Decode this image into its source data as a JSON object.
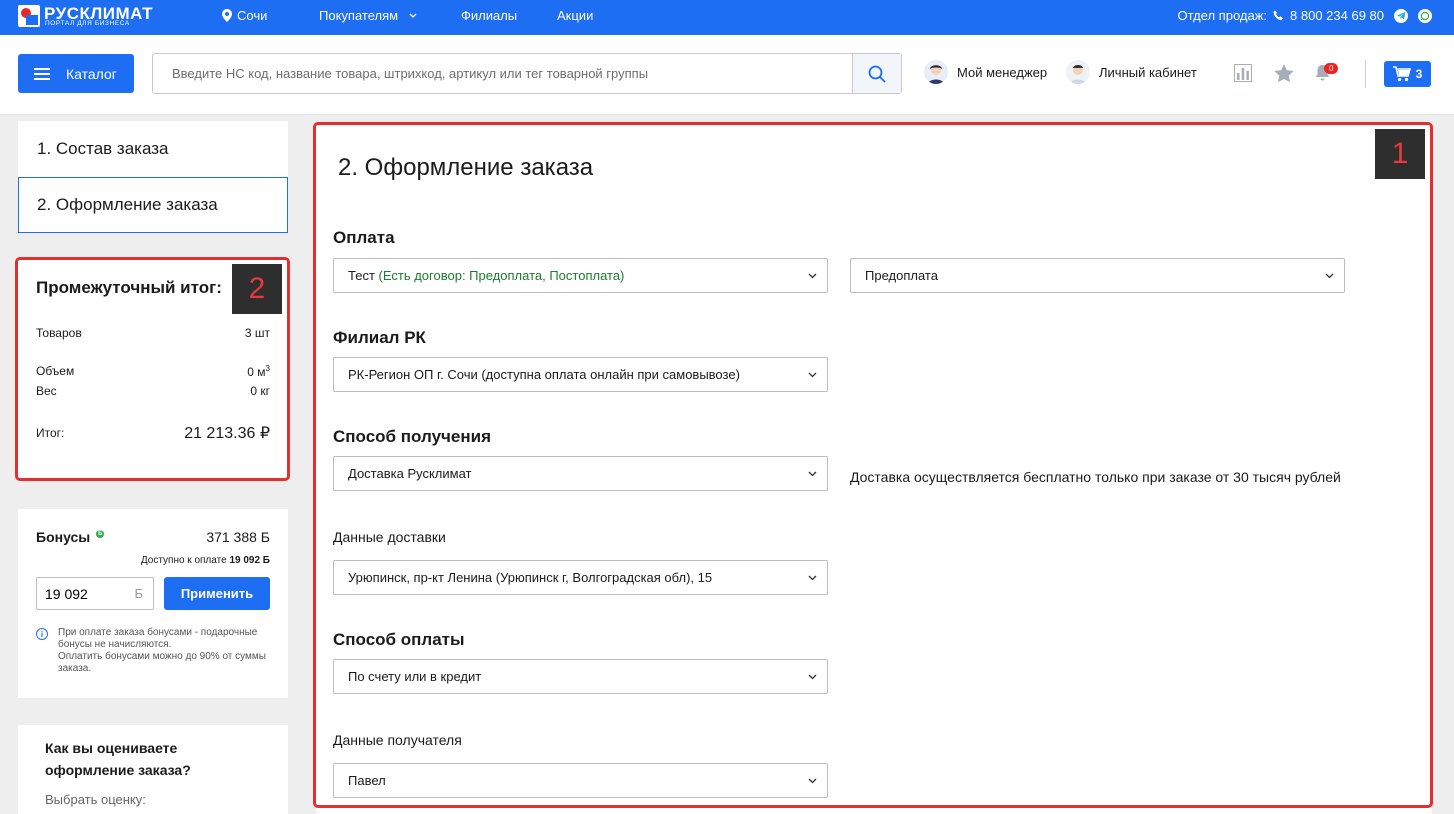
{
  "topbar": {
    "logo_text": "РУСКЛИМАТ",
    "logo_sub": "ПОРТАЛ ДЛЯ БИЗНЕСА",
    "city": "Сочи",
    "nav": [
      "Покупателям",
      "Филиалы",
      "Акции"
    ],
    "sales_label": "Отдел продаж:",
    "phone": "8 800 234 69 80"
  },
  "header": {
    "catalog_label": "Каталог",
    "search_placeholder": "Введите НС код, название товара, штрихкод, артикул или тег товарной группы",
    "manager_label": "Мой менеджер",
    "cabinet_label": "Личный кабинет",
    "notif_count": "0",
    "cart_count": "3"
  },
  "steps": [
    "1. Состав заказа",
    "2. Оформление заказа"
  ],
  "subtotal": {
    "title": "Промежуточный итог:",
    "goods_label": "Товаров",
    "goods_value": "3 шт",
    "volume_label": "Объем",
    "volume_value": "0 м",
    "volume_sup": "3",
    "weight_label": "Вес",
    "weight_value": "0 кг",
    "total_label": "Итог:",
    "total_value": "21 213.36 ₽"
  },
  "bonus": {
    "title": "Бонусы",
    "icon_char": "Б",
    "value": "371 388 Б",
    "avail_label": "Доступно к оплате",
    "avail_value": "19 092 Б",
    "input_value": "19 092",
    "input_unit": "Б",
    "apply_label": "Применить",
    "note1": "При оплате заказа бонусами - подарочные бонусы не начисляются.",
    "note2": "Оплатить бонусами можно до 90% от суммы заказа."
  },
  "rating": {
    "title": "Как вы оцениваете оформление заказа?",
    "subtitle": "Выбрать оценку:"
  },
  "markers": [
    "1",
    "2"
  ],
  "checkout": {
    "title": "2. Оформление заказа",
    "payment_heading": "Оплата",
    "payer_name": "Тест",
    "payer_contract": "(Есть договор: Предоплата, Постоплата)",
    "payment_type": "Предоплата",
    "branch_heading": "Филиал РК",
    "branch_value": "РК-Регион ОП г. Сочи (доступна оплата онлайн при самовывозе)",
    "receive_heading": "Способ получения",
    "receive_value": "Доставка Русклимат",
    "delivery_note": "Доставка осуществляется бесплатно только при заказе от 30 тысяч рублей",
    "delivery_label": "Данные доставки",
    "delivery_value": "Урюпинск, пр-кт Ленина (Урюпинск г, Волгоградская обл), 15",
    "paymethod_heading": "Способ оплаты",
    "paymethod_value": "По счету или в кредит",
    "recipient_label": "Данные получателя",
    "recipient_value": "Павел"
  },
  "colors": {
    "brand_blue": "#1d6ef2",
    "annotation_red": "#e32f2f",
    "contract_green": "#1e7a2e"
  }
}
